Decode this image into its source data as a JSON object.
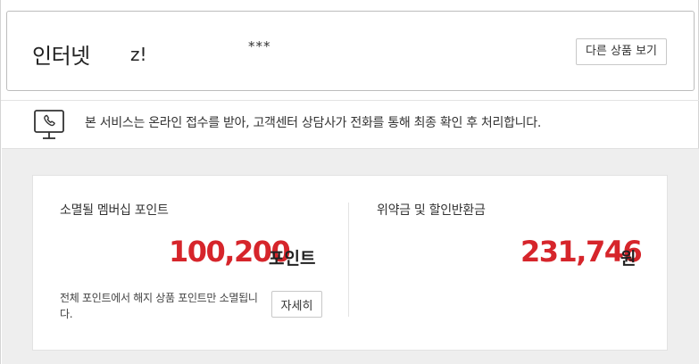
{
  "product": {
    "name": "인터넷",
    "suffix": "z!",
    "masked": "***",
    "other_button": "다른 상품 보기"
  },
  "notice": {
    "icon": "phone-monitor-icon",
    "text": "본 서비스는 온라인 접수를 받아, 고객센터 상담사가 전화를 통해 최종 확인 후 처리합니다."
  },
  "points": {
    "membership": {
      "label": "소멸될 멤버십 포인트",
      "value": "100,200",
      "unit": "포인트",
      "desc": "전체 포인트에서 해지 상품 포인트만 소멸됩니다.",
      "detail_button": "자세히"
    },
    "penalty": {
      "label": "위약금 및 할인반환금",
      "value": "231,746",
      "unit": "원"
    }
  },
  "colors": {
    "accent": "#d6252b",
    "gray_bg": "#eeeeee"
  }
}
